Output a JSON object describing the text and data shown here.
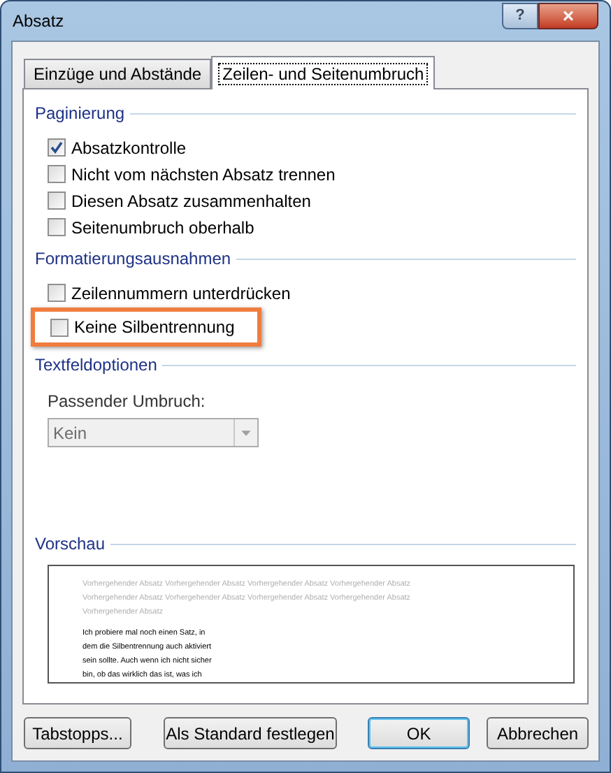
{
  "window": {
    "title": "Absatz",
    "buttons": [
      "?",
      "×"
    ]
  },
  "tabs": [
    {
      "label": "Einzüge und Abstände",
      "selected": false
    },
    {
      "label": "Zeilen- und Seitenumbruch",
      "selected": true
    }
  ],
  "sections": [
    {
      "title": "Paginierung",
      "options": [
        {
          "label": "Absatzkontrolle",
          "checked": true,
          "highlighted": false
        },
        {
          "label": "Nicht vom nächsten Absatz trennen",
          "checked": false,
          "highlighted": false
        },
        {
          "label": "Diesen Absatz zusammenhalten",
          "checked": false,
          "highlighted": false
        },
        {
          "label": "Seitenumbruch oberhalb",
          "checked": false,
          "highlighted": false
        }
      ]
    },
    {
      "title": "Formatierungsausnahmen",
      "options": [
        {
          "label": "Zeilennummern unterdrücken",
          "checked": false,
          "highlighted": false
        },
        {
          "label": "Keine Silbentrennung",
          "checked": false,
          "highlighted": true
        }
      ]
    },
    {
      "title": "Textfeldoptionen",
      "dropdown": {
        "label": "Passender Umbruch:",
        "value": "Kein",
        "disabled": true
      }
    }
  ],
  "preview": {
    "title": "Vorschau",
    "previous_lines": [
      "Vorhergehender Absatz Vorhergehender Absatz Vorhergehender Absatz Vorhergehender Absatz",
      "Vorhergehender Absatz Vorhergehender Absatz Vorhergehender Absatz Vorhergehender Absatz",
      "Vorhergehender Absatz"
    ],
    "current_lines": [
      "Ich probiere mal noch einen Satz, in",
      "dem die Silbentrennung auch aktiviert",
      "sein sollte. Auch wenn ich nicht sicher",
      "bin, ob das wirklich das ist, was ich"
    ]
  },
  "buttons": [
    {
      "label": "Tabstopps...",
      "default": false
    },
    {
      "label": "Als Standard festlegen",
      "default": false
    },
    {
      "label": "OK",
      "default": true
    },
    {
      "label": "Abbrechen",
      "default": false
    }
  ]
}
